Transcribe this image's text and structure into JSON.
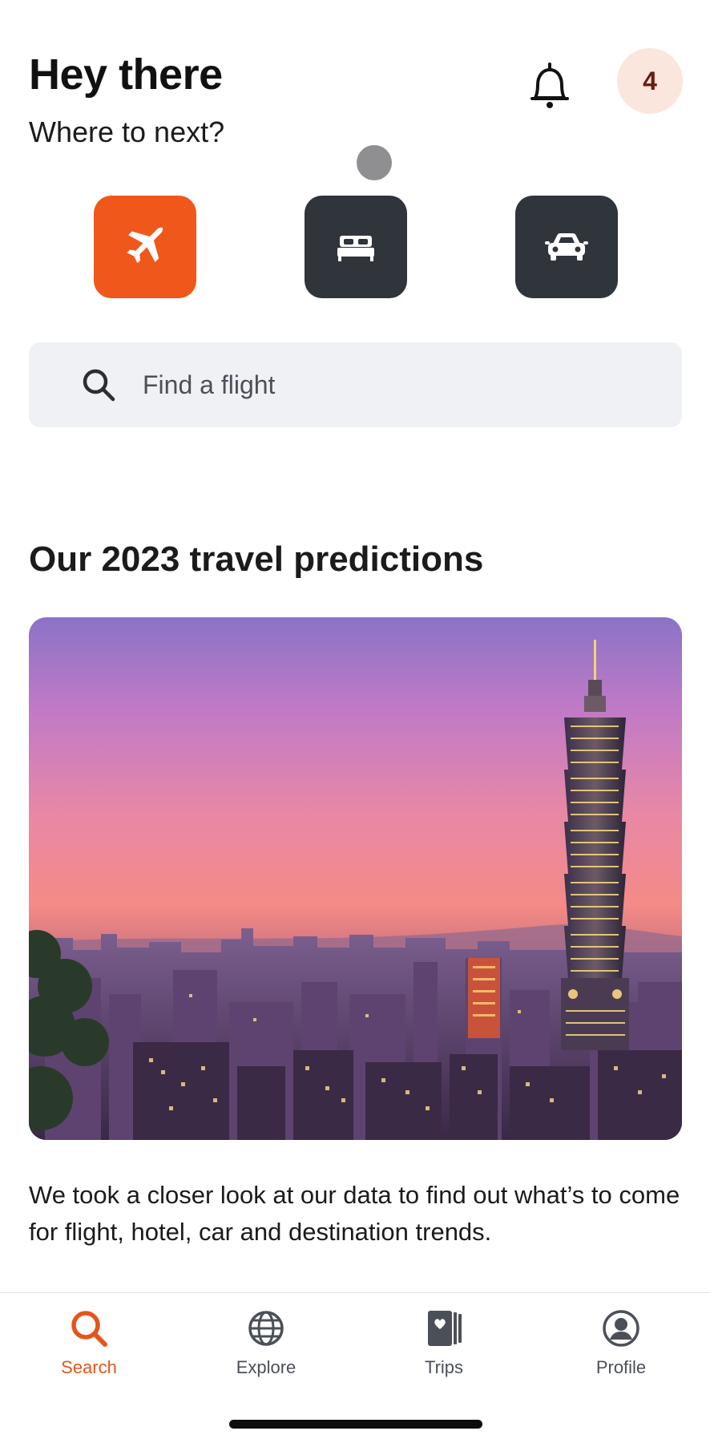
{
  "header": {
    "title": "Hey there",
    "subtitle": "Where to next?",
    "notifications_icon": "bell-icon",
    "badge_count": "4"
  },
  "verticals": [
    {
      "name": "flights",
      "icon": "airplane-icon",
      "active": true
    },
    {
      "name": "stays",
      "icon": "bed-icon",
      "active": false
    },
    {
      "name": "cars",
      "icon": "car-icon",
      "active": false
    }
  ],
  "search": {
    "placeholder": "Find a flight",
    "icon": "search-icon"
  },
  "feature": {
    "title": "Our 2023 travel predictions",
    "image": "taipei-skyline-at-sunset",
    "description": "We took a closer look at our data to find out what’s to come for flight, hotel, car and destination trends."
  },
  "bottom_nav": {
    "items": [
      {
        "label": "Search",
        "icon": "search-icon",
        "active": true
      },
      {
        "label": "Explore",
        "icon": "globe-icon",
        "active": false
      },
      {
        "label": "Trips",
        "icon": "trips-icon",
        "active": false
      },
      {
        "label": "Profile",
        "icon": "profile-icon",
        "active": false
      }
    ]
  },
  "colors": {
    "accent": "#f0571a",
    "accent_text": "#e4551b",
    "vertical_inactive": "#30343b",
    "search_bg": "#eff1f4",
    "badge_bg": "#fbe6dd"
  }
}
